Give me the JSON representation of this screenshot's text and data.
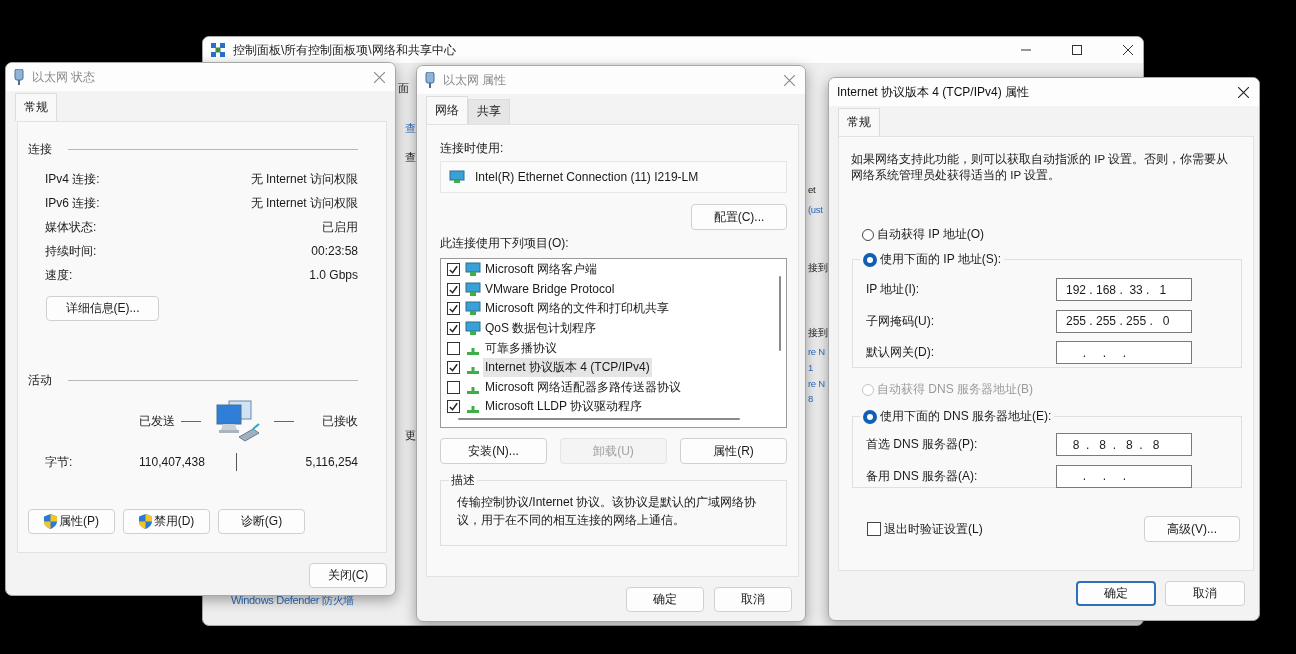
{
  "background_window": {
    "title": "控制面板\\所有控制面板项\\网络和共享中心",
    "fragments": [
      {
        "text": "面",
        "kind": "text"
      },
      {
        "text": "查",
        "kind": "link"
      },
      {
        "text": "查",
        "kind": "text"
      },
      {
        "text": "更",
        "kind": "text"
      },
      {
        "text": "et",
        "kind": "text"
      },
      {
        "text": "(ust",
        "kind": "link"
      },
      {
        "text": "接到",
        "kind": "text"
      },
      {
        "text": "接到",
        "kind": "text"
      },
      {
        "text": "re N",
        "kind": "link"
      },
      {
        "text": "1",
        "kind": "link"
      },
      {
        "text": "re N",
        "kind": "link"
      },
      {
        "text": "8",
        "kind": "link"
      },
      {
        "text": "Windows Defender 防火墙",
        "kind": "link"
      }
    ]
  },
  "status_window": {
    "title": "以太网 状态",
    "tabs": [
      {
        "label": "常规",
        "selected": true
      }
    ],
    "connection": {
      "heading": "连接",
      "rows": [
        {
          "label": "IPv4 连接:",
          "value": "无 Internet 访问权限"
        },
        {
          "label": "IPv6 连接:",
          "value": "无 Internet 访问权限"
        },
        {
          "label": "媒体状态:",
          "value": "已启用"
        },
        {
          "label": "持续时间:",
          "value": "00:23:58"
        },
        {
          "label": "速度:",
          "value": "1.0 Gbps"
        }
      ]
    },
    "details_button": "详细信息(E)...",
    "activity": {
      "heading": "活动",
      "sent_label": "已发送",
      "received_label": "已接收",
      "bytes_label": "字节:",
      "sent": "110,407,438",
      "received": "5,116,254"
    },
    "buttons": [
      {
        "label": "属性(P)",
        "shield": true
      },
      {
        "label": "禁用(D)",
        "shield": true
      },
      {
        "label": "诊断(G)",
        "shield": false
      }
    ],
    "close_button": "关闭(C)"
  },
  "properties_window": {
    "title": "以太网 属性",
    "tabs": [
      {
        "label": "网络",
        "selected": true
      },
      {
        "label": "共享",
        "selected": false
      }
    ],
    "connect_using_label": "连接时使用:",
    "adapter": "Intel(R) Ethernet Connection (11) I219-LM",
    "configure_button": "配置(C)...",
    "items_label": "此连接使用下列项目(O):",
    "items": [
      {
        "label": "Microsoft 网络客户端",
        "checked": true,
        "selected": false,
        "kind": "service"
      },
      {
        "label": "VMware Bridge Protocol",
        "checked": true,
        "selected": false,
        "kind": "service"
      },
      {
        "label": "Microsoft 网络的文件和打印机共享",
        "checked": true,
        "selected": false,
        "kind": "service"
      },
      {
        "label": "QoS 数据包计划程序",
        "checked": true,
        "selected": false,
        "kind": "service"
      },
      {
        "label": "可靠多播协议",
        "checked": false,
        "selected": false,
        "kind": "protocol"
      },
      {
        "label": "Internet 协议版本 4 (TCP/IPv4)",
        "checked": true,
        "selected": true,
        "kind": "protocol"
      },
      {
        "label": "Microsoft 网络适配器多路传送器协议",
        "checked": false,
        "selected": false,
        "kind": "protocol"
      },
      {
        "label": "Microsoft LLDP 协议驱动程序",
        "checked": true,
        "selected": false,
        "kind": "protocol"
      }
    ],
    "item_buttons": [
      {
        "label": "安装(N)...",
        "disabled": false
      },
      {
        "label": "卸载(U)",
        "disabled": true
      },
      {
        "label": "属性(R)",
        "disabled": false
      }
    ],
    "description": {
      "legend": "描述",
      "text": "传输控制协议/Internet 协议。该协议是默认的广域网络协议，用于在不同的相互连接的网络上通信。"
    },
    "buttons": [
      {
        "label": "确定",
        "default": false
      },
      {
        "label": "取消",
        "default": false
      }
    ]
  },
  "ipv4_window": {
    "title": "Internet 协议版本 4 (TCP/IPv4) 属性",
    "tabs": [
      {
        "label": "常规",
        "selected": true
      }
    ],
    "intro": "如果网络支持此功能，则可以获取自动指派的 IP 设置。否则，你需要从网络系统管理员处获得适当的 IP 设置。",
    "ip_auto": {
      "label": "自动获得 IP 地址(O)",
      "selected": false,
      "disabled": false
    },
    "ip_manual": {
      "label": "使用下面的 IP 地址(S):",
      "selected": true,
      "disabled": false,
      "fields": [
        {
          "label": "IP 地址(I):",
          "value": "192 . 168 .  33 .   1"
        },
        {
          "label": "子网掩码(U):",
          "value": "255 . 255 . 255 .   0"
        },
        {
          "label": "默认网关(D):",
          "value": "     .     .     .    "
        }
      ]
    },
    "dns_auto": {
      "label": "自动获得 DNS 服务器地址(B)",
      "selected": false,
      "disabled": true
    },
    "dns_manual": {
      "label": "使用下面的 DNS 服务器地址(E):",
      "selected": true,
      "disabled": false,
      "fields": [
        {
          "label": "首选 DNS 服务器(P):",
          "value": "  8  .   8  .   8  .   8"
        },
        {
          "label": "备用 DNS 服务器(A):",
          "value": "     .     .     .    "
        }
      ]
    },
    "validate": {
      "label": "退出时验证设置(L)",
      "checked": false
    },
    "advanced_button": "高级(V)...",
    "buttons": [
      {
        "label": "确定",
        "default": true
      },
      {
        "label": "取消",
        "default": false
      }
    ]
  }
}
